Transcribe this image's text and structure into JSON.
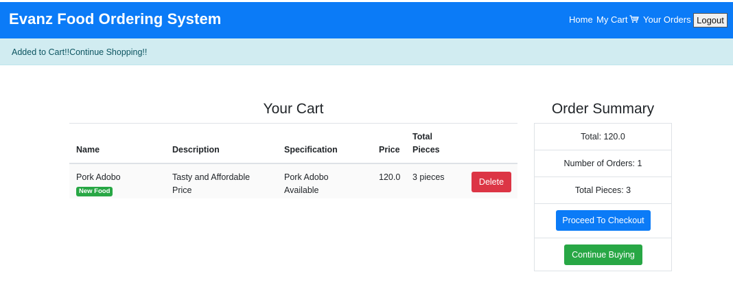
{
  "navbar": {
    "brand": "Evanz Food Ordering System",
    "home": "Home",
    "my_cart": "My Cart",
    "your_orders": "Your Orders",
    "logout": "Logout",
    "color": "#0b7bf7"
  },
  "alert": {
    "message": "Added to Cart!!Continue Shopping!!"
  },
  "cart": {
    "title": "Your Cart",
    "columns": {
      "name": "Name",
      "description": "Description",
      "specification": "Specification",
      "price": "Price",
      "total_pieces": "Total Pieces"
    },
    "rows": [
      {
        "name": "Pork Adobo",
        "badge": "New Food",
        "description": "Tasty and Affordable Price",
        "specification": "Pork Adobo Available",
        "price": "120.0",
        "pieces": "3 pieces",
        "delete_label": "Delete"
      }
    ]
  },
  "summary": {
    "title": "Order Summary",
    "total": "Total: 120.0",
    "number_of_orders": "Number of Orders: 1",
    "total_pieces": "Total Pieces: 3",
    "checkout_label": "Proceed To Checkout",
    "continue_label": "Continue Buying"
  }
}
